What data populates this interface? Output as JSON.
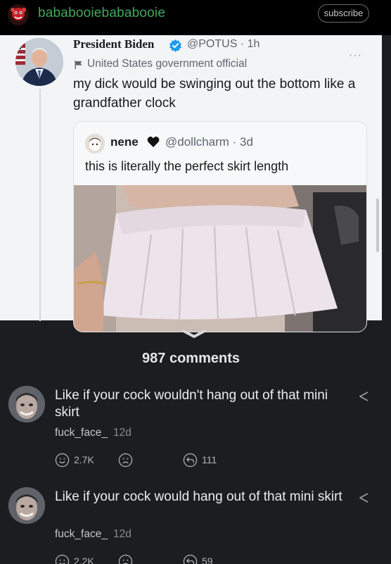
{
  "header": {
    "username": "bababooiebababooie",
    "subscribe_label": "subscribe"
  },
  "tweet": {
    "display_name": "President Biden",
    "handle_time": "@POTUS · 1h",
    "account_label": "United States government official",
    "text": "my dick would be swinging out the bottom like a grandfather clock",
    "more_label": "···"
  },
  "quoted_tweet": {
    "display_name": "nene",
    "handle_time": "@dollcharm · 3d",
    "text": "this is literally the perfect skirt length"
  },
  "comments_section": {
    "count_label": "987 comments",
    "comments": [
      {
        "text": "Like if your cock wouldn't hang out of that mini skirt",
        "username": "fuck_face_",
        "time": "12d",
        "likes": "2.7K",
        "replies": "111"
      },
      {
        "text": "Like if your cock would hang out of that mini skirt",
        "username": "fuck_face_",
        "time": "12d",
        "likes": "2.2K",
        "replies": "59"
      }
    ]
  },
  "icons": {
    "verified": "verified-badge-icon",
    "flag": "government-flag-icon",
    "heart": "heart-icon",
    "chevron": "chevron-down-icon",
    "share": "share-icon",
    "like": "smiley-icon",
    "dislike": "frown-icon",
    "reply": "reply-icon"
  },
  "colors": {
    "username_green": "#3fa85c",
    "background": "#1c1d20",
    "verified_blue": "#1d9bf0"
  }
}
